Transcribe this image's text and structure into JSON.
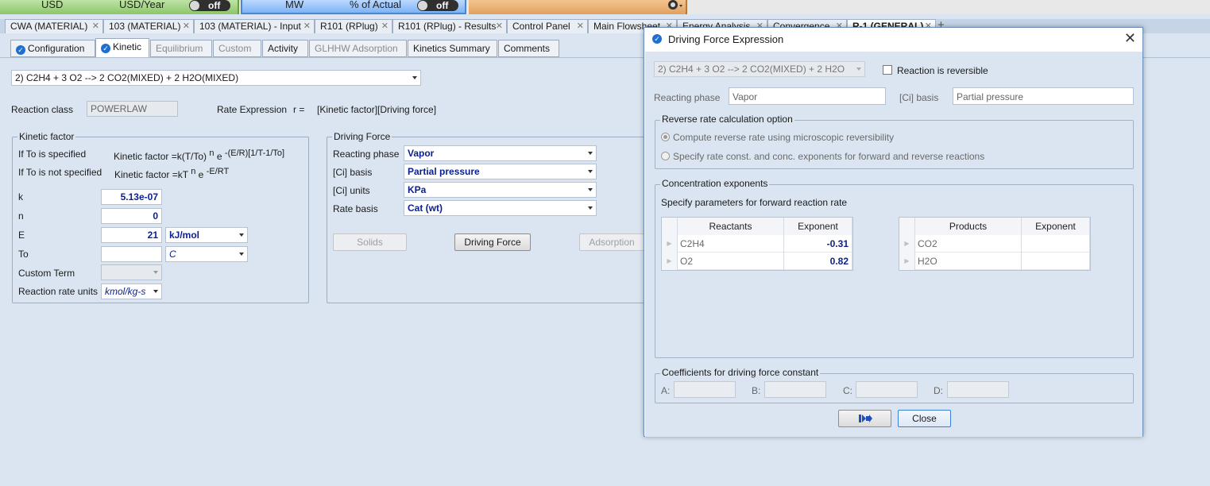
{
  "top_strip": {
    "cost_unit": "USD",
    "cost_rate": "USD/Year",
    "cost_toggle": "off",
    "energy_unit": "MW",
    "energy_pct": "% of Actual",
    "energy_toggle": "off"
  },
  "doc_tabs": [
    {
      "label": "CWA (MATERIAL)"
    },
    {
      "label": "103 (MATERIAL)"
    },
    {
      "label": "103 (MATERIAL) - Input"
    },
    {
      "label": "R101 (RPlug)"
    },
    {
      "label": "R101 (RPlug) - Results"
    },
    {
      "label": "Control Panel"
    },
    {
      "label": "Main Flowsheet"
    },
    {
      "label": "Energy Analysis"
    },
    {
      "label": "Convergence"
    },
    {
      "label": "R-1 (GENERAL)"
    }
  ],
  "sub_tabs": [
    {
      "label": "Configuration"
    },
    {
      "label": "Kinetic"
    },
    {
      "label": "Equilibrium"
    },
    {
      "label": "Custom"
    },
    {
      "label": "Activity"
    },
    {
      "label": "GLHHW Adsorption"
    },
    {
      "label": "Kinetics Summary"
    },
    {
      "label": "Comments"
    }
  ],
  "main": {
    "reaction_select": "2) C2H4  + 3 O2  -->  2 CO2(MIXED) + 2 H2O(MIXED)",
    "reaction_class_label": "Reaction class",
    "reaction_class_value": "POWERLAW",
    "rate_expr_label": "Rate Expression",
    "rate_expr_r": "r =",
    "rate_expr_value": "[Kinetic factor][Driving force]",
    "kinetic_factor": {
      "title": "Kinetic factor",
      "if_to_specified": "If To is specified",
      "if_to_not_specified": "If To is not specified",
      "kf_label": "Kinetic factor =",
      "kf1_base": "k(T/To)",
      "kf1_n": "n",
      "kf1_e": "e",
      "kf1_exp": "-(E/R)[1/T-1/To]",
      "kf2_base": "kT",
      "kf2_n": "n",
      "kf2_e": "e",
      "kf2_exp": "-E/RT",
      "k_label": "k",
      "k_value": "5.13e-07",
      "n_label": "n",
      "n_value": "0",
      "E_label": "E",
      "E_value": "21",
      "E_unit": "kJ/mol",
      "To_label": "To",
      "To_value": "",
      "To_unit": "C",
      "custom_term_label": "Custom Term",
      "custom_term_value": "",
      "rate_units_label": "Reaction rate units",
      "rate_units_value": "kmol/kg-s"
    },
    "driving_force": {
      "title": "Driving Force",
      "reacting_phase_label": "Reacting phase",
      "reacting_phase_value": "Vapor",
      "ci_basis_label": "[Ci] basis",
      "ci_basis_value": "Partial pressure",
      "ci_units_label": "[Ci] units",
      "ci_units_value": "KPa",
      "rate_basis_label": "Rate basis",
      "rate_basis_value": "Cat (wt)",
      "solids_btn": "Solids",
      "driving_force_btn": "Driving Force",
      "adsorption_btn": "Adsorption"
    }
  },
  "dialog": {
    "title": "Driving Force Expression",
    "reaction_select": "2) C2H4  + 3 O2  -->  2 CO2(MIXED) + 2 H2O",
    "reversible_label": "Reaction is reversible",
    "reacting_phase_label": "Reacting phase",
    "reacting_phase_value": "Vapor",
    "ci_basis_label": "[Ci] basis",
    "ci_basis_value": "Partial pressure",
    "reverse_group_title": "Reverse rate calculation option",
    "reverse_opt1": "Compute reverse rate using microscopic  reversibility",
    "reverse_opt2": "Specify rate const. and conc. exponents for forward and reverse reactions",
    "conc_group_title": "Concentration exponents",
    "conc_subtitle": "Specify parameters for forward reaction rate",
    "reactants_header": "Reactants",
    "exponent_header": "Exponent",
    "products_header": "Products",
    "products_exponent_header": "Exponent",
    "reactants": [
      {
        "name": "C2H4",
        "exp": "-0.31"
      },
      {
        "name": "O2",
        "exp": "0.82"
      }
    ],
    "products": [
      {
        "name": "CO2",
        "exp": ""
      },
      {
        "name": "H2O",
        "exp": ""
      }
    ],
    "coef_group_title": "Coefficients for driving force constant",
    "coef_a": "A:",
    "coef_b": "B:",
    "coef_c": "C:",
    "coef_d": "D:",
    "close_btn": "Close"
  }
}
